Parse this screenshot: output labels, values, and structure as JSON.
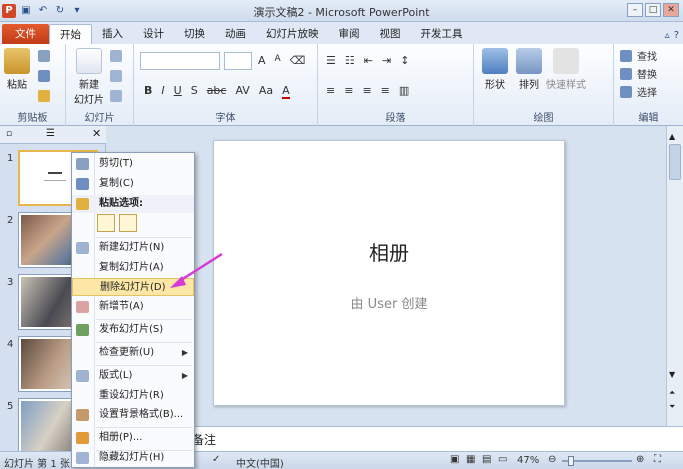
{
  "window": {
    "title": "演示文稿2 - Microsoft PowerPoint",
    "buttons": [
      "minimize",
      "maximize",
      "close"
    ]
  },
  "ribbon_tabs": [
    "文件",
    "开始",
    "插入",
    "设计",
    "切换",
    "动画",
    "幻灯片放映",
    "审阅",
    "视图",
    "开发工具"
  ],
  "active_tab": "开始",
  "ribbon": {
    "clipboard": {
      "paste": "粘贴",
      "label": "剪贴板"
    },
    "slides": {
      "new_slide": "新建",
      "new_slide2": "幻灯片",
      "label": "幻灯片"
    },
    "font": {
      "label": "字体",
      "bold": "B",
      "italic": "I",
      "underline": "U",
      "shadow": "S",
      "strike": "abc",
      "aa": "Aa",
      "grow": "A",
      "shrink": "A"
    },
    "paragraph": {
      "label": "段落"
    },
    "drawing": {
      "shape": "形状",
      "arrange": "排列",
      "quick_styles": "快速样式",
      "label": "绘图"
    },
    "editing": {
      "find": "查找",
      "replace": "替换",
      "select": "选择",
      "label": "编辑"
    }
  },
  "slides": [
    {
      "num": "1"
    },
    {
      "num": "2"
    },
    {
      "num": "3"
    },
    {
      "num": "4"
    },
    {
      "num": "5"
    }
  ],
  "context_menu": {
    "cut": "剪切(T)",
    "copy": "复制(C)",
    "paste_options": "粘贴选项:",
    "new_slide": "新建幻灯片(N)",
    "duplicate_slide": "复制幻灯片(A)",
    "delete_slide": "删除幻灯片(D)",
    "new_section": "新增节(A)",
    "publish_slides": "发布幻灯片(S)",
    "check_updates": "检查更新(U)",
    "layout": "版式(L)",
    "reset_slide": "重设幻灯片(R)",
    "format_background": "设置背景格式(B)...",
    "photo_album": "相册(P)...",
    "hide_slide": "隐藏幻灯片(H)"
  },
  "main_slide": {
    "title": "相册",
    "subtitle": "由 User 创建"
  },
  "notes": {
    "placeholder": "备注"
  },
  "status": {
    "slide": "幻灯片 第 1 张",
    "lang": "中文(中国)",
    "zoom": "47%"
  },
  "colors": {
    "file_tab": "#d24726",
    "highlight": "#fde7a7",
    "arrow": "#d63ad6"
  }
}
